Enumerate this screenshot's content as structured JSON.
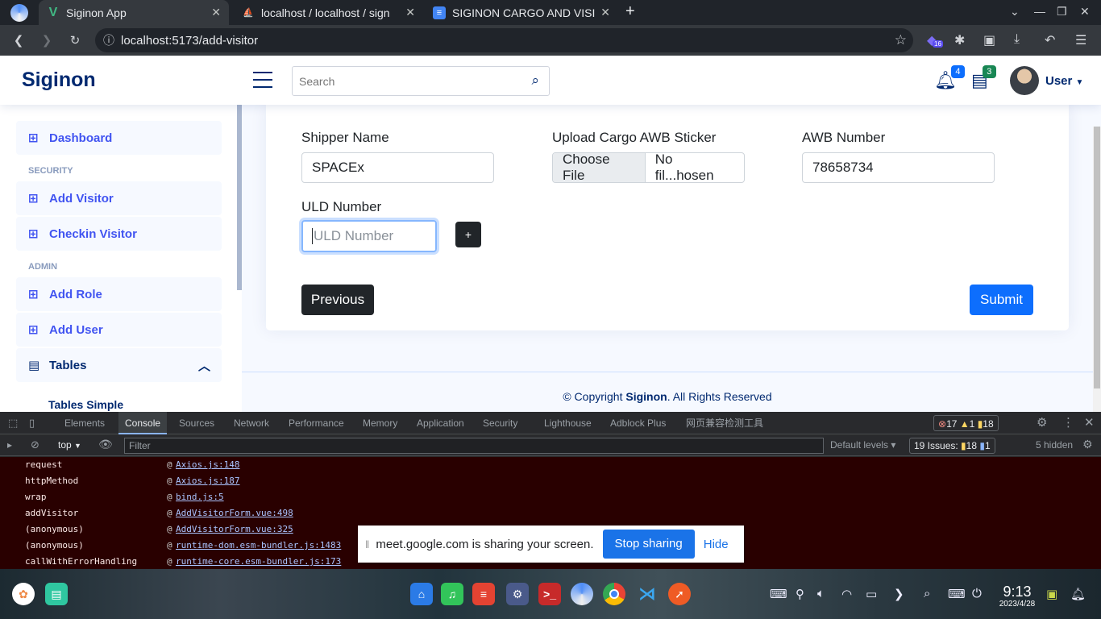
{
  "browser": {
    "tabs": [
      {
        "title": "Siginon App",
        "active": true
      },
      {
        "title": "localhost / localhost / sign",
        "active": false
      },
      {
        "title": "SIGINON CARGO AND VISI",
        "active": false
      }
    ],
    "url": "localhost:5173/add-visitor",
    "extension_badge": "16"
  },
  "header": {
    "logo": "Siginon",
    "search_placeholder": "Search",
    "notifications_count": "4",
    "messages_count": "3",
    "user": "User"
  },
  "sidebar": {
    "dashboard": "Dashboard",
    "security_heading": "SECURITY",
    "add_visitor": "Add Visitor",
    "checkin_visitor": "Checkin Visitor",
    "admin_heading": "ADMIN",
    "add_role": "Add Role",
    "add_user": "Add User",
    "tables": "Tables",
    "tables_simple": "Tables Simple"
  },
  "form": {
    "shipper_label": "Shipper Name",
    "shipper_value": "SPACEx",
    "awb_sticker_label": "Upload Cargo AWB Sticker",
    "choose_file": "Choose File",
    "no_file": "No fil...hosen",
    "awb_number_label": "AWB Number",
    "awb_number_value": "78658734",
    "uld_label": "ULD Number",
    "uld_placeholder": "ULD Number",
    "add_button": "+",
    "previous": "Previous",
    "submit": "Submit"
  },
  "footer": {
    "prefix": "© Copyright ",
    "brand": "Siginon",
    "suffix": ". All Rights Reserved"
  },
  "devtools": {
    "tabs": [
      "Elements",
      "Console",
      "Sources",
      "Network",
      "Performance",
      "Memory",
      "Application",
      "Security",
      "Lighthouse",
      "Adblock Plus",
      "网页兼容检测工具"
    ],
    "errors": "17",
    "warnings": "1",
    "info": "18",
    "context": "top",
    "filter_placeholder": "Filter",
    "levels": "Default levels",
    "issues_label": "19 Issues:",
    "issues_warn": "18",
    "issues_info": "1",
    "hidden": "5 hidden",
    "stack": [
      {
        "fn": "request",
        "src": "Axios.js:148"
      },
      {
        "fn": "httpMethod",
        "src": "Axios.js:187"
      },
      {
        "fn": "wrap",
        "src": "bind.js:5"
      },
      {
        "fn": "addVisitor",
        "src": "AddVisitorForm.vue:498"
      },
      {
        "fn": "(anonymous)",
        "src": "AddVisitorForm.vue:325"
      },
      {
        "fn": "(anonymous)",
        "src": "runtime-dom.esm-bundler.js:1483"
      },
      {
        "fn": "callWithErrorHandling",
        "src": "runtime-core.esm-bundler.js:173"
      }
    ]
  },
  "screen_share": {
    "message": "meet.google.com is sharing your screen.",
    "stop": "Stop sharing",
    "hide": "Hide"
  },
  "taskbar": {
    "time": "9:13",
    "date": "2023/4/28"
  },
  "colors": {
    "brand": "#012970",
    "accent": "#4154f1",
    "primary_button": "#0d6efd",
    "dark_button": "#212529",
    "console_error_bg": "#290000"
  }
}
